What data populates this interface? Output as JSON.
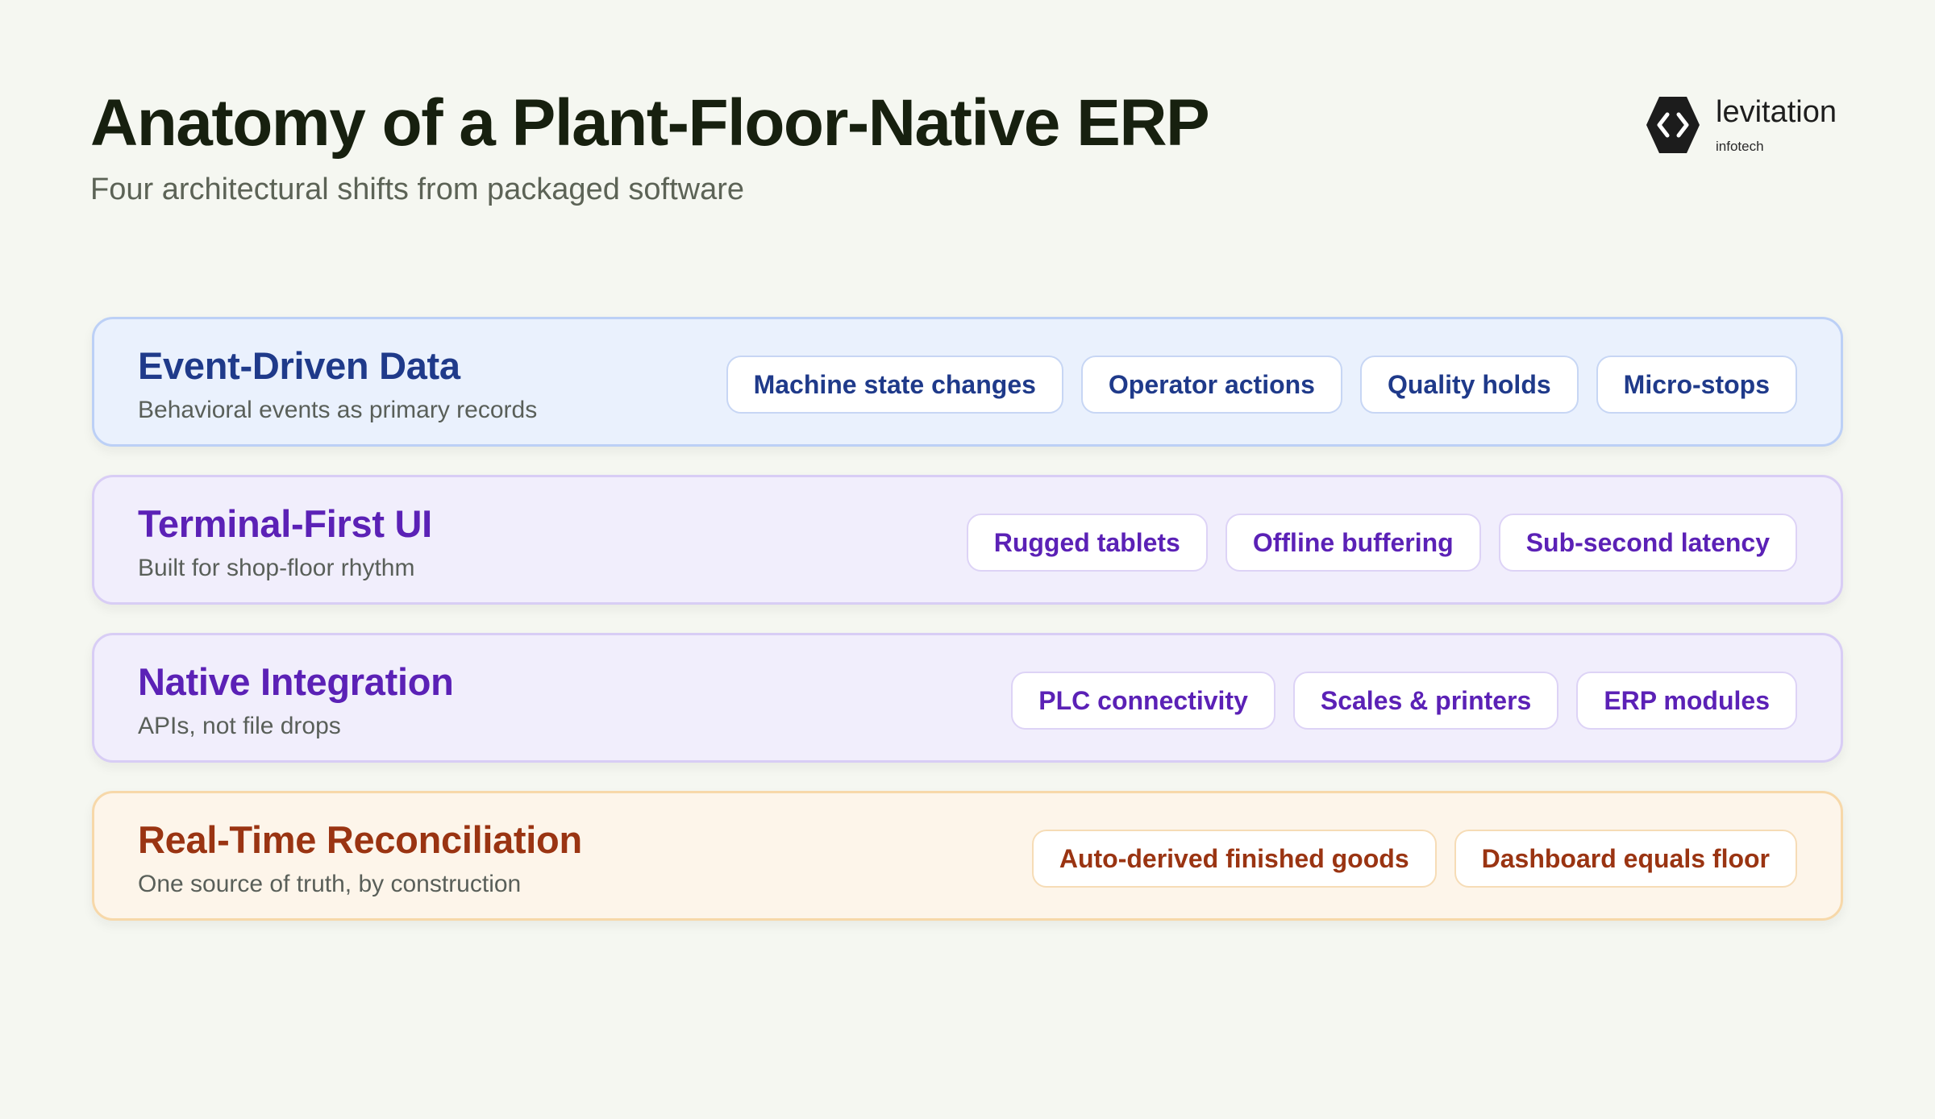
{
  "header": {
    "title": "Anatomy of a Plant-Floor-Native ERP",
    "subtitle": "Four architectural shifts from packaged software"
  },
  "brand": {
    "name": "levitation",
    "tagline": "infotech",
    "icon": "hexagon-code-icon"
  },
  "layers": [
    {
      "title": "Event-Driven Data",
      "subtitle": "Behavioral events as primary records",
      "accent": "#1f3a8a",
      "chips": [
        "Machine state changes",
        "Operator actions",
        "Quality holds",
        "Micro-stops"
      ]
    },
    {
      "title": "Terminal-First UI",
      "subtitle": "Built for shop-floor rhythm",
      "accent": "#5b21b6",
      "chips": [
        "Rugged tablets",
        "Offline buffering",
        "Sub-second latency"
      ]
    },
    {
      "title": "Native Integration",
      "subtitle": "APIs, not file drops",
      "accent": "#5b21b6",
      "chips": [
        "PLC connectivity",
        "Scales & printers",
        "ERP modules"
      ]
    },
    {
      "title": "Real-Time Reconciliation",
      "subtitle": "One source of truth, by construction",
      "accent": "#9a3412",
      "chips": [
        "Auto-derived finished goods",
        "Dashboard equals floor"
      ]
    }
  ]
}
